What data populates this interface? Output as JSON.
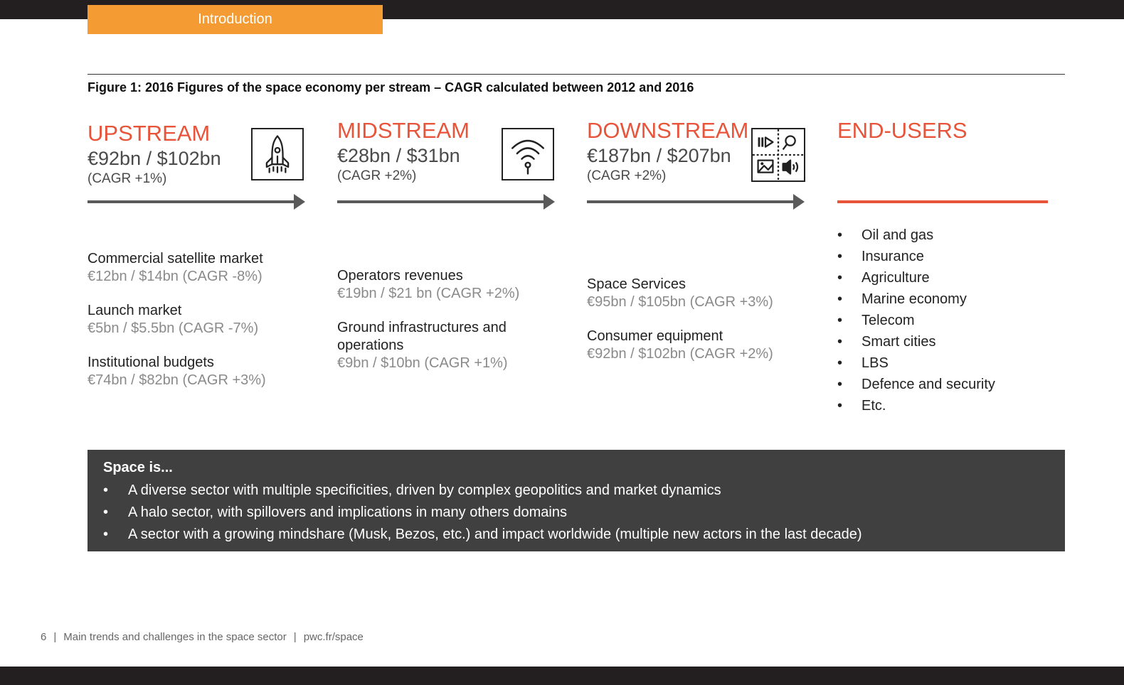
{
  "header": {
    "section_tab": "Introduction"
  },
  "figure": {
    "title": "Figure 1: 2016 Figures of the space economy per stream – CAGR calculated between 2012 and 2016"
  },
  "streams": [
    {
      "title": "UPSTREAM",
      "value": "€92bn / $102bn",
      "cagr": "(CAGR +1%)",
      "icon": "rocket-icon",
      "items": [
        {
          "name": "Commercial satellite market",
          "value": "€12bn / $14bn (CAGR -8%)"
        },
        {
          "name": "Launch market",
          "value": "€5bn / $5.5bn (CAGR -7%)"
        },
        {
          "name": "Institutional budgets",
          "value": "€74bn / $82bn (CAGR +3%)"
        }
      ]
    },
    {
      "title": "MIDSTREAM",
      "value": "€28bn / $31bn",
      "cagr": "(CAGR +2%)",
      "icon": "wifi-icon",
      "items": [
        {
          "name": "Operators revenues",
          "value": "€19bn / $21 bn (CAGR +2%)"
        },
        {
          "name": "Ground infrastructures and operations",
          "value": "€9bn / $10bn (CAGR +1%)"
        }
      ]
    },
    {
      "title": "DOWNSTREAM",
      "value": "€187bn / $207bn",
      "cagr": "(CAGR +2%)",
      "icon": "media-grid-icon",
      "items": [
        {
          "name": "Space Services",
          "value": "€95bn / $105bn (CAGR +3%)"
        },
        {
          "name": "Consumer equipment",
          "value": "€92bn / $102bn (CAGR +2%)"
        }
      ]
    }
  ],
  "end_users": {
    "title": "END-USERS",
    "items": [
      "Oil and gas",
      "Insurance",
      "Agriculture",
      "Marine economy",
      "Telecom",
      "Smart cities",
      "LBS",
      "Defence and security",
      "Etc."
    ]
  },
  "space_is": {
    "heading": "Space is...",
    "points": [
      "A diverse sector with multiple specificities, driven by complex geopolitics and market dynamics",
      "A halo sector, with spillovers and implications in many others domains",
      "A sector with a growing mindshare (Musk, Bezos, etc.) and impact worldwide (multiple new actors in the last decade)"
    ]
  },
  "footer": {
    "page_number": "6",
    "doc_title": "Main trends and challenges in the space sector",
    "url": "pwc.fr/space",
    "separator": "|"
  },
  "colors": {
    "accent_orange": "#f49b33",
    "stream_red": "#e8543a",
    "dark_box": "#404041",
    "arrow_gray": "#5a5a5a"
  }
}
